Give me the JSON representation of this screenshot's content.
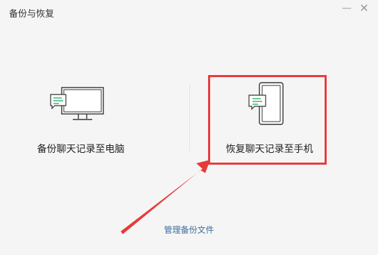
{
  "window": {
    "title": "备份与恢复",
    "minimize_label": "—",
    "close_label": "✕"
  },
  "options": {
    "backup_pc_label": "备份聊天记录至电脑",
    "restore_phone_label": "恢复聊天记录至手机"
  },
  "footer": {
    "manage_link_label": "管理备份文件"
  },
  "colors": {
    "highlight": "#e93a3a",
    "bubble_green": "#2aae67",
    "link": "#3b6e9e"
  },
  "icons": [
    "computer-icon",
    "chat-bubble-icon",
    "phone-icon",
    "annotation-arrow"
  ]
}
